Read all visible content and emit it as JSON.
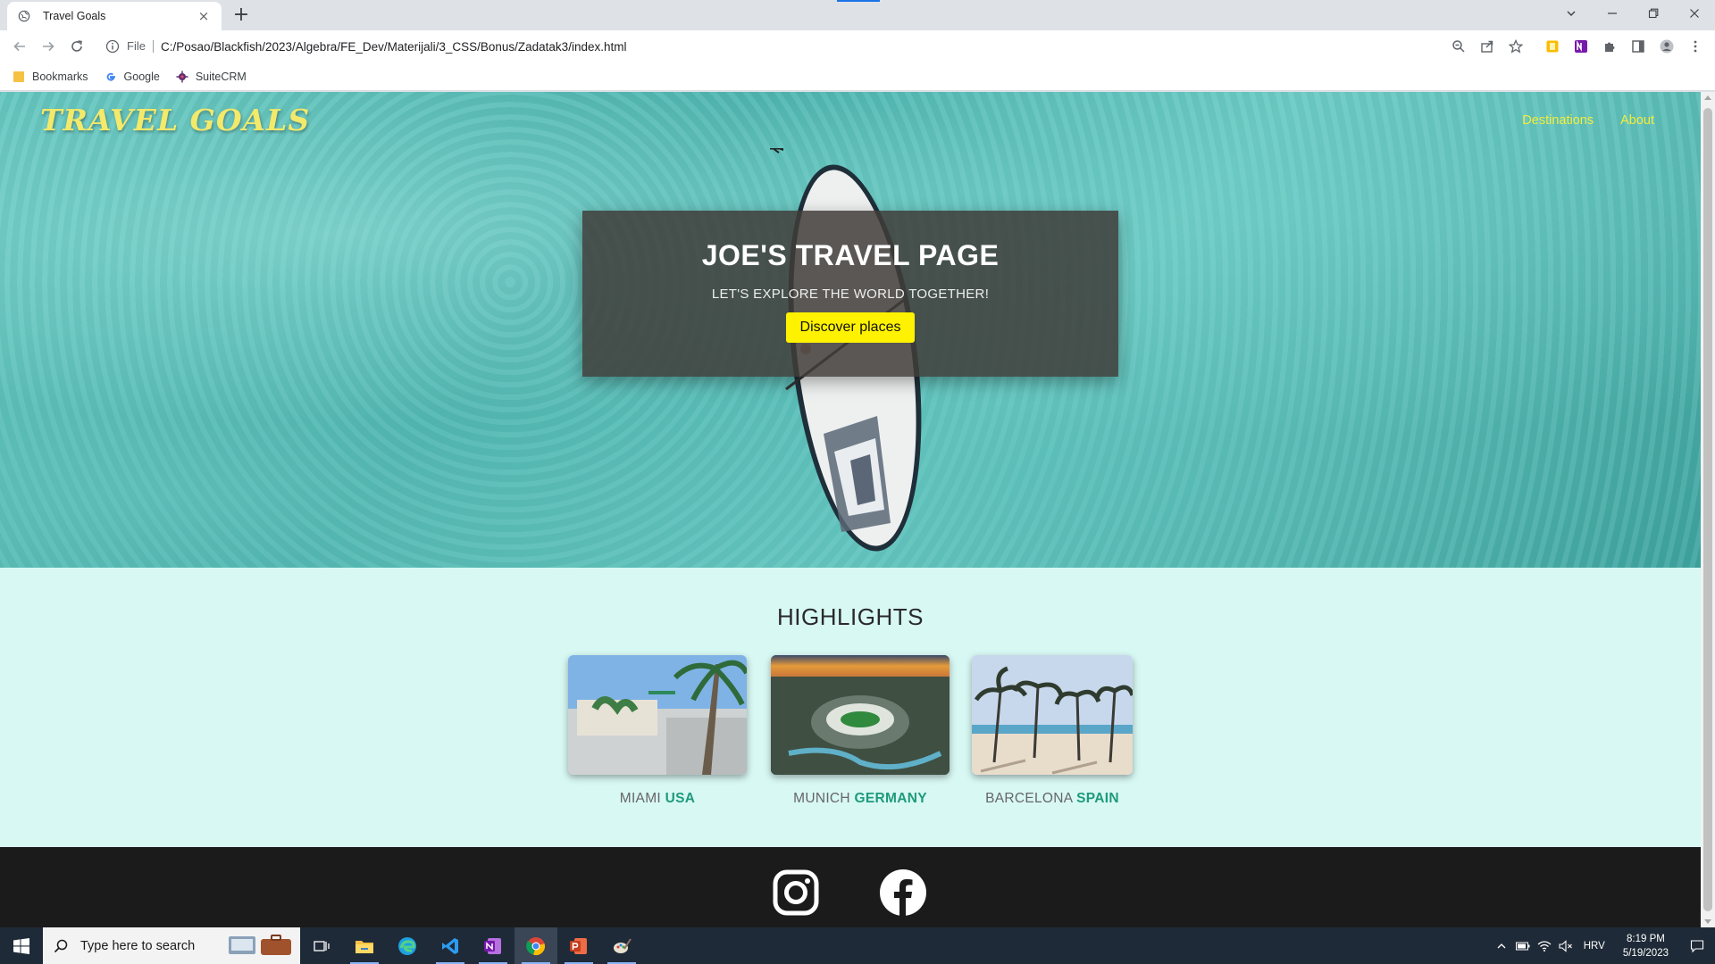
{
  "browser": {
    "tab_title": "Travel Goals",
    "tab_close": "×",
    "new_tab": "+",
    "scheme_label": "File",
    "url": "C:/Posao/Blackfish/2023/Algebra/FE_Dev/Materijali/3_CSS/Bonus/Zadatak3/index.html",
    "bookmarks": [
      {
        "label": "Bookmarks",
        "icon": "folder-icon"
      },
      {
        "label": "Google",
        "icon": "google-icon"
      },
      {
        "label": "SuiteCRM",
        "icon": "suitecrm-icon"
      }
    ]
  },
  "page": {
    "logo": "TRAVEL GOALS",
    "nav": [
      "Destinations",
      "About"
    ],
    "hero": {
      "title": "JOE'S TRAVEL PAGE",
      "tagline": "LET'S EXPLORE THE WORLD TOGETHER!",
      "cta": "Discover places"
    },
    "highlights": {
      "heading": "HIGHLIGHTS",
      "items": [
        {
          "city": "MIAMI",
          "country": "USA"
        },
        {
          "city": "MUNICH",
          "country": "GERMANY"
        },
        {
          "city": "BARCELONA",
          "country": "SPAIN"
        }
      ]
    },
    "footer": {
      "icons": [
        "instagram-icon",
        "facebook-icon"
      ]
    },
    "colors": {
      "accent_yellow": "#f4ed3a",
      "cta_yellow": "#fff200",
      "country_green": "#1f9a7b",
      "highlights_bg": "#d8f8f4",
      "footer_bg": "#1b1b1b"
    }
  },
  "taskbar": {
    "search_placeholder": "Type here to search",
    "language": "HRV",
    "time": "8:19 PM",
    "date": "5/19/2023"
  }
}
